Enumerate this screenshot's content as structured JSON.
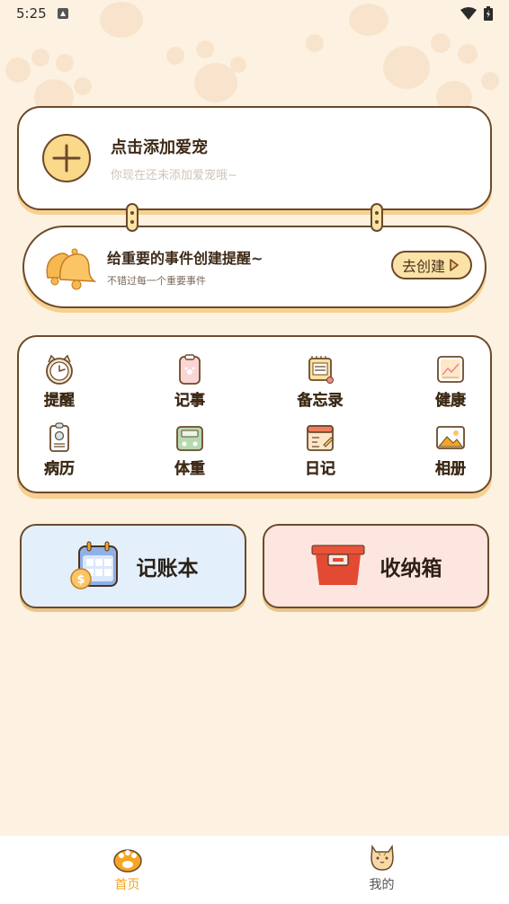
{
  "status_bar": {
    "time": "5:25"
  },
  "add_pet": {
    "title": "点击添加爱宠",
    "subtitle": "你现在还未添加爱宠哦~"
  },
  "reminder": {
    "title": "给重要的事件创建提醒~",
    "subtitle": "不错过每一个重要事件",
    "button": "去创建"
  },
  "features": [
    {
      "label": "提醒",
      "icon": "clock-icon"
    },
    {
      "label": "记事",
      "icon": "clipboard-icon"
    },
    {
      "label": "备忘录",
      "icon": "memo-icon"
    },
    {
      "label": "健康",
      "icon": "chart-icon"
    },
    {
      "label": "病历",
      "icon": "medical-record-icon"
    },
    {
      "label": "体重",
      "icon": "scale-icon"
    },
    {
      "label": "日记",
      "icon": "diary-icon"
    },
    {
      "label": "相册",
      "icon": "photo-icon"
    }
  ],
  "tiles": {
    "ledger": {
      "label": "记账本",
      "color": "#e3f0fc"
    },
    "storage": {
      "label": "收纳箱",
      "color": "#fde6df"
    }
  },
  "tabbar": {
    "home": {
      "label": "首页",
      "color": "#f5a623"
    },
    "mine": {
      "label": "我的",
      "color": "#555555"
    }
  }
}
